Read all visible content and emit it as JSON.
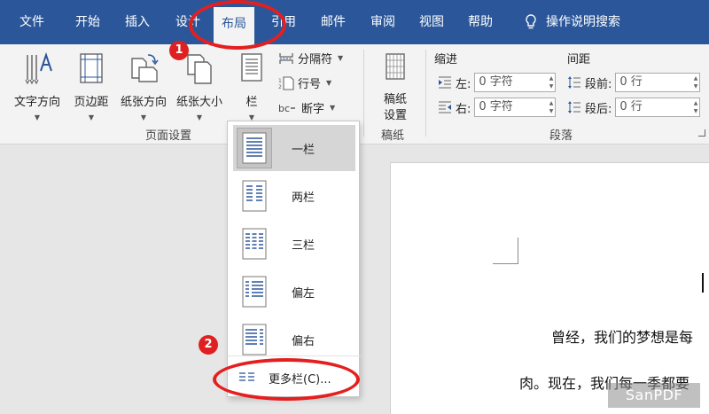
{
  "tabs": [
    {
      "label": "文件",
      "key": "file"
    },
    {
      "label": "开始",
      "key": "home"
    },
    {
      "label": "插入",
      "key": "insert"
    },
    {
      "label": "设计",
      "key": "design"
    },
    {
      "label": "布局",
      "key": "layout",
      "active": true
    },
    {
      "label": "引用",
      "key": "references"
    },
    {
      "label": "邮件",
      "key": "mailings"
    },
    {
      "label": "审阅",
      "key": "review"
    },
    {
      "label": "视图",
      "key": "view"
    },
    {
      "label": "帮助",
      "key": "help"
    }
  ],
  "tell_me": "操作说明搜索",
  "page_setup": {
    "text_direction": "文字方向",
    "margins": "页边距",
    "orientation": "纸张方向",
    "size": "纸张大小",
    "columns": "栏",
    "breaks": "分隔符",
    "line_numbers": "行号",
    "hyphenation": "断字",
    "group_label": "页面设置"
  },
  "manuscript": {
    "button": "稿纸设置",
    "group_label": "稿纸"
  },
  "paragraph": {
    "indent_title": "缩进",
    "spacing_title": "间距",
    "left_label": "左:",
    "left_value": "0 字符",
    "right_label": "右:",
    "right_value": "0 字符",
    "before_label": "段前:",
    "before_value": "0 行",
    "after_label": "段后:",
    "after_value": "0 行",
    "group_label": "段落"
  },
  "columns_menu": {
    "items": [
      "一栏",
      "两栏",
      "三栏",
      "偏左",
      "偏右"
    ],
    "more": "更多栏(C)..."
  },
  "document": {
    "line1": "曾经，我们的梦想是每",
    "line2": "肉。现在，我们每一季都要"
  },
  "annotations": {
    "badge1": "1",
    "badge2": "2",
    "color": "#e41f1f"
  },
  "watermark": "SanPDF",
  "colors": {
    "tabbar": "#2b579a",
    "ribbon": "#f3f3f3",
    "selected_item": "#d6d6d6"
  }
}
